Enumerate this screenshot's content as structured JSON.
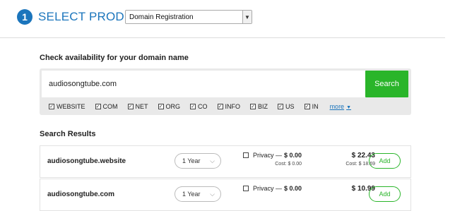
{
  "step": {
    "number": "1",
    "title": "SELECT PRODUCT:"
  },
  "product_select": {
    "value": "Domain Registration"
  },
  "availability": {
    "title": "Check availability for your domain name",
    "query": "audiosongtube.com",
    "search_label": "Search",
    "tlds": [
      {
        "label": "WEBSITE",
        "checked": true
      },
      {
        "label": "COM",
        "checked": true
      },
      {
        "label": "NET",
        "checked": true
      },
      {
        "label": "ORG",
        "checked": true
      },
      {
        "label": "CO",
        "checked": true
      },
      {
        "label": "INFO",
        "checked": true
      },
      {
        "label": "BIZ",
        "checked": true
      },
      {
        "label": "US",
        "checked": true
      },
      {
        "label": "IN",
        "checked": true
      }
    ],
    "more_label": "more"
  },
  "results": {
    "title": "Search Results",
    "rows": [
      {
        "domain": "audiosongtube.website",
        "term": "1 Year",
        "privacy_label": "Privacy —",
        "privacy_price": "$ 0.00",
        "privacy_cost": "Cost: $ 0.00",
        "price": "$ 22.43",
        "cost": "Cost: $ 18.69",
        "add_label": "Add"
      },
      {
        "domain": "audiosongtube.com",
        "term": "1 Year",
        "privacy_label": "Privacy —",
        "privacy_price": "$ 0.00",
        "privacy_cost": "",
        "price": "$ 10.99",
        "cost": "",
        "add_label": "Add"
      }
    ]
  },
  "colors": {
    "brand_blue": "#1b75bc",
    "search_green": "#2ab52a"
  }
}
